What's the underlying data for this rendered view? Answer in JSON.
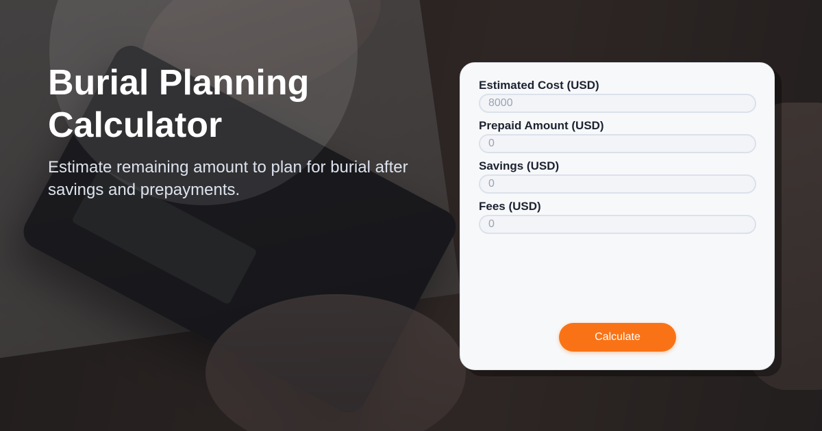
{
  "hero": {
    "title": "Burial Planning Calculator",
    "subtitle": "Estimate remaining amount to plan for burial after savings and prepayments."
  },
  "form": {
    "fields": [
      {
        "label": "Estimated Cost (USD)",
        "placeholder": "8000"
      },
      {
        "label": "Prepaid Amount (USD)",
        "placeholder": "0"
      },
      {
        "label": "Savings (USD)",
        "placeholder": "0"
      },
      {
        "label": "Fees (USD)",
        "placeholder": "0"
      }
    ],
    "submit_label": "Calculate"
  },
  "colors": {
    "accent": "#f97316",
    "card_background": "#f7f8fa",
    "title_text": "#ffffff",
    "subtitle_text": "#dde3ee",
    "label_text": "#1c2230",
    "input_placeholder": "#9aa3b2"
  }
}
